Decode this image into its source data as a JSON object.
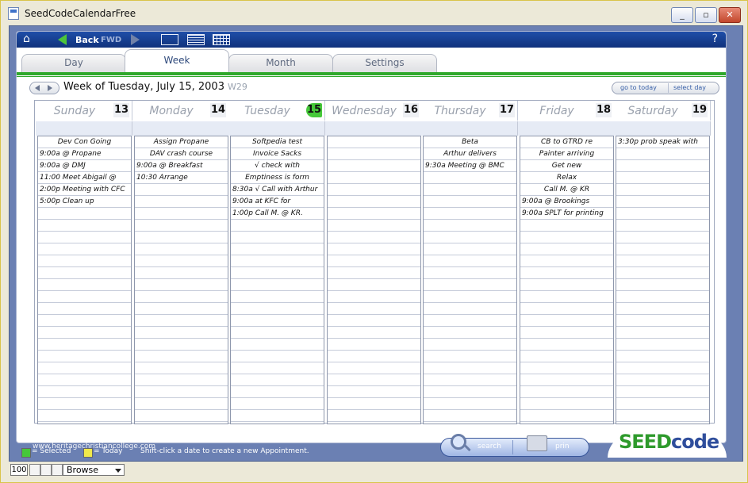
{
  "window": {
    "title": "SeedCodeCalendarFree"
  },
  "nav": {
    "back": "Back",
    "fwd": "FWD",
    "help": "?"
  },
  "tabs": [
    "Day",
    "Week",
    "Month",
    "Settings"
  ],
  "active_tab": "Week",
  "week": {
    "title": "Week of Tuesday, July 15, 2003",
    "weeknum": "W29"
  },
  "buttons": {
    "goto_today": "go to today",
    "select_day": "select day",
    "search": "search",
    "print": "prin"
  },
  "logo": {
    "seed": "SEED",
    "code": "code"
  },
  "legend": {
    "selected": "= Selected",
    "today": "= Today",
    "hint": "Shift-click a date to create a new Appointment."
  },
  "watermark": "www.heritagechristiancollege.com",
  "status": {
    "zoom": "100",
    "mode": "Browse"
  },
  "colors": {
    "accent_green": "#2fa82b",
    "today": "#46c83a",
    "nav_blue": "#1f4ea8"
  },
  "days": [
    {
      "name": "Sunday",
      "num": "13",
      "items": [
        {
          "t": "Dev Con Going",
          "c": true
        },
        {
          "t": "9:00a  @ Propane"
        },
        {
          "t": "9:00a  @ DMJ"
        },
        {
          "t": "11:00  Meet Abigail @"
        },
        {
          "t": "2:00p  Meeting with CFC"
        },
        {
          "t": "5:00p  Clean up"
        }
      ]
    },
    {
      "name": "Monday",
      "num": "14",
      "items": [
        {
          "t": "Assign Propane",
          "c": true
        },
        {
          "t": "DAV crash course",
          "c": true
        },
        {
          "t": "9:00a  @ Breakfast"
        },
        {
          "t": "10:30  Arrange"
        }
      ]
    },
    {
      "name": "Tuesday",
      "num": "15",
      "today": true,
      "items": [
        {
          "t": "Softpedia test",
          "c": true
        },
        {
          "t": "Invoice Sacks",
          "c": true
        },
        {
          "t": "√ check with",
          "c": true
        },
        {
          "t": "Emptiness is form",
          "c": true
        },
        {
          "t": "8:30a  √ Call with Arthur"
        },
        {
          "t": "9:00a  at KFC for"
        },
        {
          "t": "1:00p  Call M. @ KR."
        }
      ]
    },
    {
      "name": "Wednesday",
      "num": "16",
      "items": []
    },
    {
      "name": "Thursday",
      "num": "17",
      "items": [
        {
          "t": "Beta",
          "c": true
        },
        {
          "t": "Arthur delivers",
          "c": true
        },
        {
          "t": "9:30a  Meeting @ BMC"
        }
      ]
    },
    {
      "name": "Friday",
      "num": "18",
      "items": [
        {
          "t": "CB to GTRD re",
          "c": true
        },
        {
          "t": "Painter arriving",
          "c": true
        },
        {
          "t": "Get new",
          "c": true
        },
        {
          "t": "Relax",
          "c": true
        },
        {
          "t": "Call M. @ KR",
          "c": true
        },
        {
          "t": "9:00a  @ Brookings"
        },
        {
          "t": "9:00a  SPLT for printing"
        }
      ]
    },
    {
      "name": "Saturday",
      "num": "19",
      "items": [
        {
          "t": "3:30p  prob speak with"
        }
      ]
    }
  ]
}
